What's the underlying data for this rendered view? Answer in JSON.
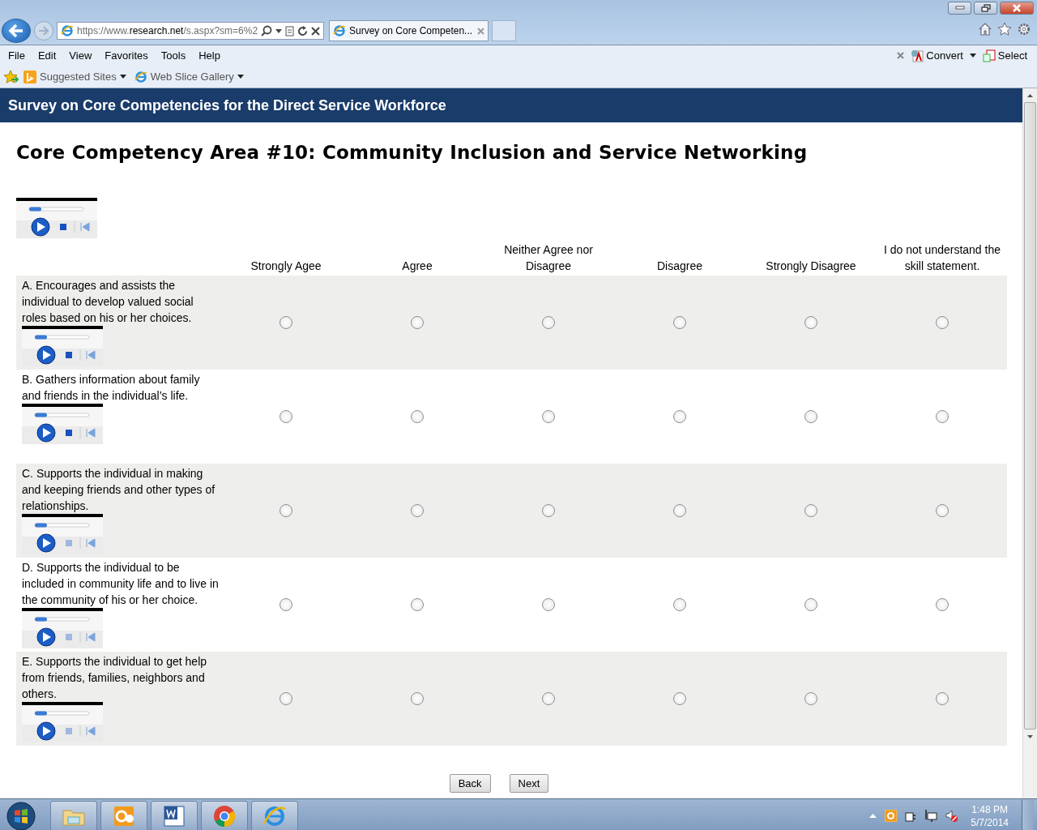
{
  "browser": {
    "address": "https://www.**research.net**/s.aspx?sm=6%2",
    "tab": {
      "title": "Survey on Core Competen...",
      "selected": true
    },
    "menu": [
      "File",
      "Edit",
      "View",
      "Favorites",
      "Tools",
      "Help"
    ],
    "favorites": [
      "Suggested Sites",
      "Web Slice Gallery"
    ],
    "tools": [
      "Convert",
      "Select"
    ]
  },
  "survey": {
    "header": "Survey on Core Competencies for the Direct Service Workforce",
    "title": "Core Competency Area #10: Community Inclusion and Service Networking",
    "columns": [
      "Strongly Agee",
      "Agree",
      "Neither Agree nor Disagree",
      "Disagree",
      "Strongly Disagree",
      "I do not understand the skill statement."
    ],
    "rows": [
      {
        "statement": "A. Encourages and assists the individual to develop valued social roles based on his or her choices.",
        "options": [
          {
            "selected": false
          },
          {
            "selected": false
          },
          {
            "selected": false
          },
          {
            "selected": false
          },
          {
            "selected": false
          },
          {
            "selected": false
          }
        ]
      },
      {
        "statement": "B. Gathers information about family and friends in the individual’s life.",
        "options": [
          {
            "selected": false
          },
          {
            "selected": false
          },
          {
            "selected": false
          },
          {
            "selected": false
          },
          {
            "selected": false
          },
          {
            "selected": false
          }
        ]
      },
      {
        "statement": "C. Supports the individual in making and keeping friends and other types of relationships.",
        "options": [
          {
            "selected": false
          },
          {
            "selected": false
          },
          {
            "selected": false
          },
          {
            "selected": false
          },
          {
            "selected": false
          },
          {
            "selected": false
          }
        ]
      },
      {
        "statement": "D. Supports the individual to be included in community life and to live in the community of his or her choice.",
        "options": [
          {
            "selected": false
          },
          {
            "selected": false
          },
          {
            "selected": false
          },
          {
            "selected": false
          },
          {
            "selected": false
          },
          {
            "selected": false
          }
        ]
      },
      {
        "statement": "E. Supports the individual to get help from friends, families, neighbors and others.",
        "options": [
          {
            "selected": false
          },
          {
            "selected": false
          },
          {
            "selected": false
          },
          {
            "selected": false
          },
          {
            "selected": false
          },
          {
            "selected": false
          }
        ]
      }
    ],
    "buttons": [
      "Back",
      "Next"
    ]
  },
  "taskbar": {
    "time": "1:48 PM",
    "date": "5/7/2014"
  }
}
